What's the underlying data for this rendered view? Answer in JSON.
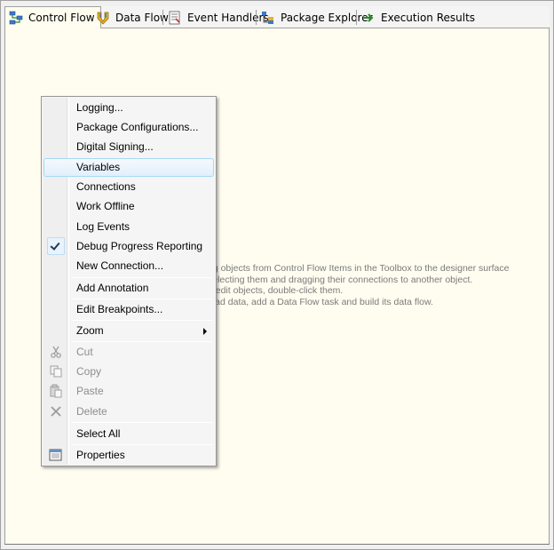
{
  "tabs": [
    {
      "label": "Control Flow",
      "icon": "control-flow-icon",
      "active": true
    },
    {
      "label": "Data Flow",
      "icon": "data-flow-icon",
      "active": false
    },
    {
      "label": "Event Handlers",
      "icon": "event-handlers-icon",
      "active": false
    },
    {
      "label": "Package Explorer",
      "icon": "package-explorer-icon",
      "active": false
    },
    {
      "label": "Execution Results",
      "icon": "execution-results-icon",
      "active": false
    }
  ],
  "designer": {
    "hints": [
      "ag objects from Control Flow Items in the Toolbox to the designer surface",
      "selecting them and dragging their connections to another object.",
      "o edit objects, double-click them.",
      "load data, add a Data Flow task and build its data flow."
    ]
  },
  "menu": {
    "items": [
      {
        "label": "Logging...",
        "enabled": true
      },
      {
        "label": "Package Configurations...",
        "enabled": true
      },
      {
        "label": "Digital Signing...",
        "enabled": true
      },
      {
        "label": "Variables",
        "enabled": true,
        "highlighted": true
      },
      {
        "label": "Connections",
        "enabled": true
      },
      {
        "label": "Work Offline",
        "enabled": true
      },
      {
        "label": "Log Events",
        "enabled": true
      },
      {
        "label": "Debug Progress Reporting",
        "enabled": true,
        "checked": true
      },
      {
        "label": "New Connection...",
        "enabled": true
      },
      {
        "label": "Add Annotation",
        "enabled": true
      },
      {
        "label": "Edit Breakpoints...",
        "enabled": true
      },
      {
        "label": "Zoom",
        "enabled": true,
        "submenu": true
      },
      {
        "label": "Cut",
        "enabled": false,
        "icon": "cut-icon"
      },
      {
        "label": "Copy",
        "enabled": false,
        "icon": "copy-icon"
      },
      {
        "label": "Paste",
        "enabled": false,
        "icon": "paste-icon"
      },
      {
        "label": "Delete",
        "enabled": false,
        "icon": "delete-icon"
      },
      {
        "label": "Select All",
        "enabled": true
      },
      {
        "label": "Properties",
        "enabled": true,
        "icon": "properties-icon"
      }
    ]
  },
  "colors": {
    "designer_bg": "#fffdf0",
    "hint_text": "#7b7b7b",
    "highlight_border": "#a8d8f5"
  }
}
